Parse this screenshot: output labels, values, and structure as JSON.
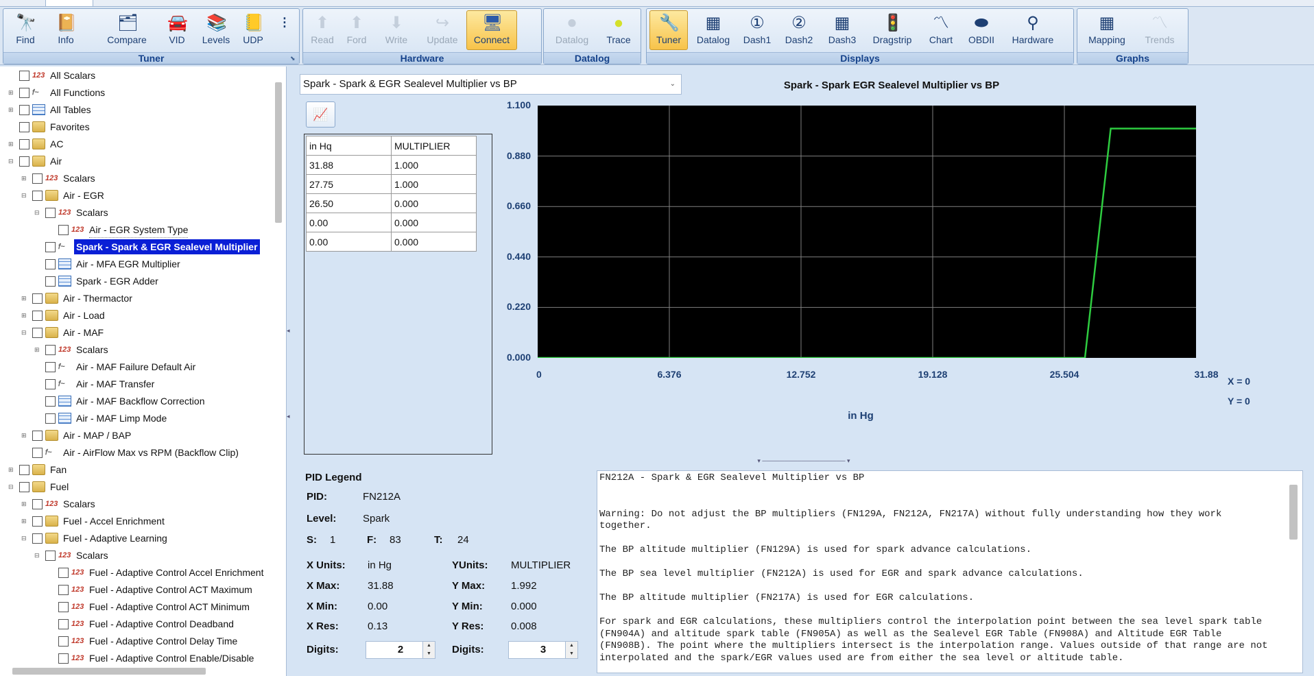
{
  "ribbon": {
    "groups": [
      {
        "caption": "Tuner",
        "buttons": [
          {
            "label": "Find",
            "icon": "binoculars-icon",
            "disabled": false,
            "active": false
          },
          {
            "label": "Info",
            "icon": "info-book-icon",
            "disabled": false,
            "active": false
          },
          {
            "label": "Compare",
            "icon": "compare-icon",
            "disabled": false,
            "active": false
          },
          {
            "label": "VID",
            "icon": "vehicle-id-icon",
            "disabled": false,
            "active": false
          },
          {
            "label": "Levels",
            "icon": "books-stack-icon",
            "disabled": false,
            "active": false
          },
          {
            "label": "UDP",
            "icon": "udp-notebook-icon",
            "disabled": false,
            "active": false
          },
          {
            "label": "",
            "icon": "binary-icon",
            "disabled": false,
            "active": false
          }
        ]
      },
      {
        "caption": "Hardware",
        "buttons": [
          {
            "label": "Read",
            "icon": "arrow-up-icon",
            "disabled": true,
            "active": false
          },
          {
            "label": "Ford",
            "icon": "arrow-up-icon",
            "disabled": true,
            "active": false
          },
          {
            "label": "Write",
            "icon": "arrow-down-icon",
            "disabled": true,
            "active": false
          },
          {
            "label": "Update",
            "icon": "update-arrow-icon",
            "disabled": true,
            "active": false
          },
          {
            "label": "Connect",
            "icon": "connect-computer-icon",
            "disabled": false,
            "active": true
          }
        ]
      },
      {
        "caption": "Datalog",
        "buttons": [
          {
            "label": "Datalog",
            "icon": "start-record-icon",
            "disabled": true,
            "active": false
          },
          {
            "label": "Trace",
            "icon": "trace-ball-icon",
            "disabled": false,
            "active": false
          }
        ]
      },
      {
        "caption": "Displays",
        "buttons": [
          {
            "label": "Tuner",
            "icon": "tuner-wrench-icon",
            "disabled": false,
            "active": true
          },
          {
            "label": "Datalog",
            "icon": "grid-icon",
            "disabled": false,
            "active": false
          },
          {
            "label": "Dash1",
            "icon": "gauge-1-icon",
            "disabled": false,
            "active": false
          },
          {
            "label": "Dash2",
            "icon": "gauge-2-icon",
            "disabled": false,
            "active": false
          },
          {
            "label": "Dash3",
            "icon": "grid-icon",
            "disabled": false,
            "active": false
          },
          {
            "label": "Dragstrip",
            "icon": "traffic-light-icon",
            "disabled": false,
            "active": false
          },
          {
            "label": "Chart",
            "icon": "chart-line-icon",
            "disabled": false,
            "active": false
          },
          {
            "label": "OBDII",
            "icon": "obd-connector-icon",
            "disabled": false,
            "active": false
          },
          {
            "label": "Hardware",
            "icon": "usb-icon",
            "disabled": false,
            "active": false
          }
        ]
      },
      {
        "caption": "Graphs",
        "buttons": [
          {
            "label": "Mapping",
            "icon": "grid-icon",
            "disabled": false,
            "active": false
          },
          {
            "label": "Trends",
            "icon": "trends-icon",
            "disabled": true,
            "active": false
          }
        ]
      }
    ]
  },
  "tree": {
    "selected": "Spark - Spark & EGR Sealevel Multiplier",
    "items": [
      {
        "label": "All Scalars",
        "type": "scalar",
        "level": 1,
        "exp": ""
      },
      {
        "label": "All Functions",
        "type": "function",
        "level": 1,
        "exp": "+"
      },
      {
        "label": "All Tables",
        "type": "table",
        "level": 1,
        "exp": "+"
      },
      {
        "label": "Favorites",
        "type": "folder",
        "level": 1,
        "exp": ""
      },
      {
        "label": "AC",
        "type": "folder",
        "level": 1,
        "exp": "+"
      },
      {
        "label": "Air",
        "type": "folder",
        "level": 1,
        "exp": "-"
      },
      {
        "label": "Scalars",
        "type": "scalar",
        "level": 2,
        "exp": "+"
      },
      {
        "label": "Air - EGR",
        "type": "folder",
        "level": 2,
        "exp": "-"
      },
      {
        "label": "Scalars",
        "type": "scalar",
        "level": 3,
        "exp": "-"
      },
      {
        "label": "Air - EGR System Type",
        "type": "scalar",
        "level": 4,
        "exp": ""
      },
      {
        "label": "Spark - Spark & EGR Sealevel Multiplier",
        "type": "function",
        "level": 3,
        "exp": ""
      },
      {
        "label": "Air - MFA EGR Multiplier",
        "type": "table",
        "level": 3,
        "exp": ""
      },
      {
        "label": "Spark - EGR Adder",
        "type": "table",
        "level": 3,
        "exp": ""
      },
      {
        "label": "Air - Thermactor",
        "type": "folder",
        "level": 2,
        "exp": "+"
      },
      {
        "label": "Air - Load",
        "type": "folder",
        "level": 2,
        "exp": "+"
      },
      {
        "label": "Air - MAF",
        "type": "folder",
        "level": 2,
        "exp": "-"
      },
      {
        "label": "Scalars",
        "type": "scalar",
        "level": 3,
        "exp": "+"
      },
      {
        "label": "Air - MAF Failure Default Air",
        "type": "function",
        "level": 3,
        "exp": ""
      },
      {
        "label": "Air - MAF Transfer",
        "type": "function",
        "level": 3,
        "exp": ""
      },
      {
        "label": "Air - MAF Backflow Correction",
        "type": "table",
        "level": 3,
        "exp": ""
      },
      {
        "label": "Air - MAF Limp Mode",
        "type": "table",
        "level": 3,
        "exp": ""
      },
      {
        "label": "Air - MAP / BAP",
        "type": "folder",
        "level": 2,
        "exp": "+"
      },
      {
        "label": "Air - AirFlow Max vs RPM (Backflow Clip)",
        "type": "function",
        "level": 2,
        "exp": ""
      },
      {
        "label": "Fan",
        "type": "folder",
        "level": 1,
        "exp": "+"
      },
      {
        "label": "Fuel",
        "type": "folder",
        "level": 1,
        "exp": "-"
      },
      {
        "label": "Scalars",
        "type": "scalar",
        "level": 2,
        "exp": "+"
      },
      {
        "label": "Fuel - Accel Enrichment",
        "type": "folder",
        "level": 2,
        "exp": "+"
      },
      {
        "label": "Fuel - Adaptive Learning",
        "type": "folder",
        "level": 2,
        "exp": "-"
      },
      {
        "label": "Scalars",
        "type": "scalar",
        "level": 3,
        "exp": "-"
      },
      {
        "label": "Fuel - Adaptive Control Accel Enrichment",
        "type": "scalar",
        "level": 4,
        "exp": ""
      },
      {
        "label": "Fuel - Adaptive Control ACT Maximum",
        "type": "scalar",
        "level": 4,
        "exp": ""
      },
      {
        "label": "Fuel - Adaptive Control ACT Minimum",
        "type": "scalar",
        "level": 4,
        "exp": ""
      },
      {
        "label": "Fuel - Adaptive Control Deadband",
        "type": "scalar",
        "level": 4,
        "exp": ""
      },
      {
        "label": "Fuel - Adaptive Control Delay Time",
        "type": "scalar",
        "level": 4,
        "exp": ""
      },
      {
        "label": "Fuel - Adaptive Control Enable/Disable",
        "type": "scalar",
        "level": 4,
        "exp": ""
      }
    ]
  },
  "editor": {
    "selector_value": "Spark - Spark & EGR Sealevel Multiplier vs BP",
    "table": {
      "headers": [
        "in Hq",
        "MULTIPLIER"
      ],
      "rows": [
        [
          "31.88",
          "1.000"
        ],
        [
          "27.75",
          "1.000"
        ],
        [
          "26.50",
          "0.000"
        ],
        [
          "0.00",
          "0.000"
        ],
        [
          "0.00",
          "0.000"
        ]
      ]
    }
  },
  "chart_data": {
    "type": "line",
    "title": "Spark - Spark  EGR Sealevel Multiplier vs BP",
    "xlabel": "in Hg",
    "ylabel": "",
    "x": [
      0,
      0,
      26.5,
      27.75,
      31.88
    ],
    "values": [
      0,
      0,
      0,
      1,
      1
    ],
    "xlim": [
      0,
      31.88
    ],
    "ylim": [
      0,
      1.1
    ],
    "xticks": [
      "0",
      "6.376",
      "12.752",
      "19.128",
      "25.504",
      "31.88"
    ],
    "yticks": [
      "1.100",
      "0.880",
      "0.660",
      "0.440",
      "0.220",
      "0.000"
    ],
    "grid": true,
    "line_color": "#2ecc40",
    "background": "#000000",
    "readout": {
      "x": "X = 0",
      "y": "Y = 0"
    }
  },
  "legend": {
    "title": "PID Legend",
    "pid_label": "PID:",
    "pid": "FN212A",
    "level_label": "Level:",
    "level": "Spark",
    "s_label": "S:",
    "s": "1",
    "f_label": "F:",
    "f": "83",
    "t_label": "T:",
    "t": "24",
    "xunits_label": "X Units:",
    "xunits": "in Hg",
    "yunits_label": "YUnits:",
    "yunits": "MULTIPLIER",
    "xmax_label": "X Max:",
    "xmax": "31.88",
    "ymax_label": "Y Max:",
    "ymax": "1.992",
    "xmin_label": "X Min:",
    "xmin": "0.00",
    "ymin_label": "Y Min:",
    "ymin": "0.000",
    "xres_label": "X Res:",
    "xres": "0.13",
    "yres_label": "Y Res:",
    "yres": "0.008",
    "digits_label": "Digits:",
    "x_digits": "2",
    "y_digits": "3"
  },
  "description": [
    "FN212A - Spark & EGR Sealevel Multiplier vs BP",
    "Warning: Do not adjust the BP multipliers (FN129A, FN212A, FN217A) without fully understanding how they work together.",
    "The BP altitude multiplier (FN129A) is used for spark advance calculations.",
    "The BP sea level multiplier (FN212A) is used for EGR and spark advance calculations.",
    "The BP altitude multiplier (FN217A) is used for EGR calculations.",
    "For spark and EGR calculations, these multipliers control the interpolation point between the sea level spark table (FN904A) and altitude spark table (FN905A) as well as the Sealevel EGR Table (FN908A) and Altitude EGR Table (FN908B). The point where the multipliers intersect is the interpolation range. Values outside of that range are not interpolated and the spark/EGR values used are from either the sea level or altitude table."
  ]
}
